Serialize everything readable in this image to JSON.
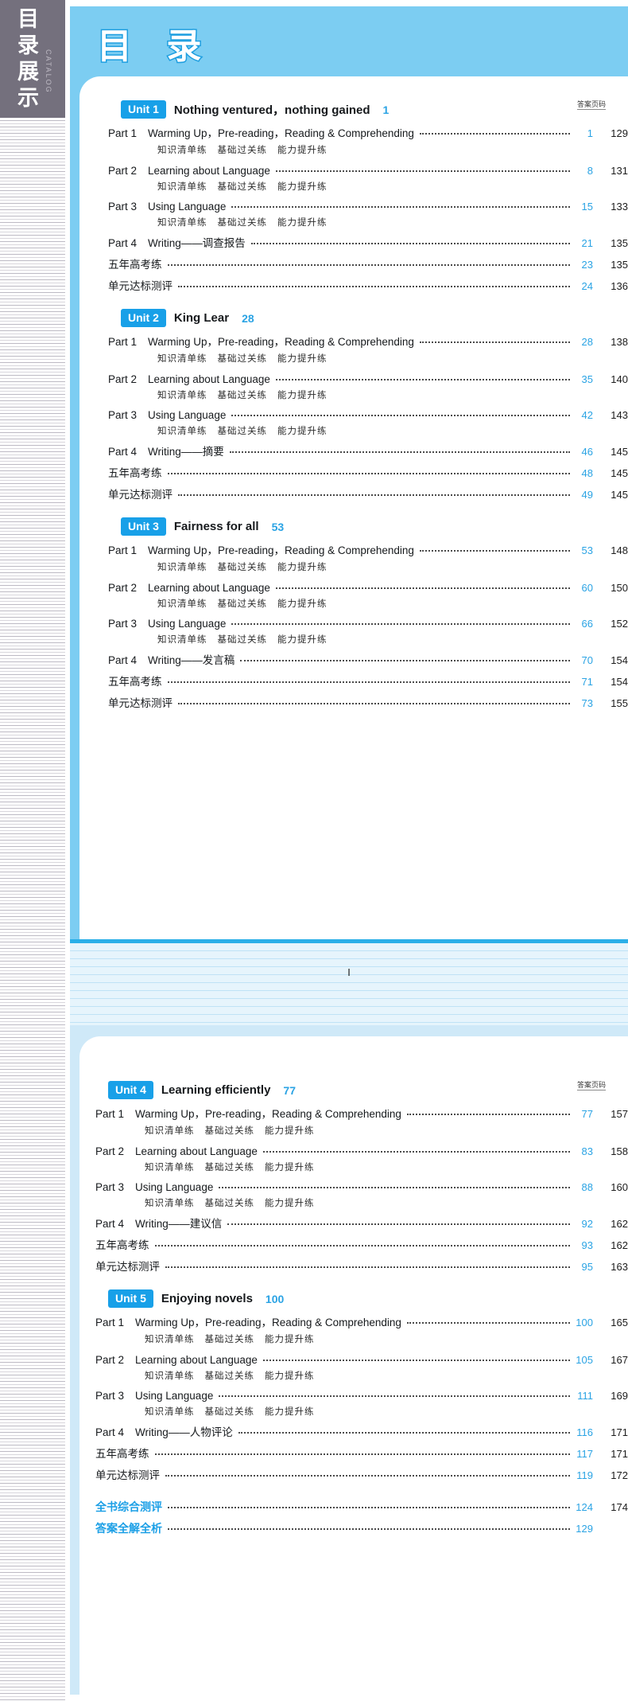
{
  "spine": {
    "title": "目录展示",
    "subtitle": "CATALOG"
  },
  "masthead": "目 录",
  "answer_header": "答案页码",
  "folio": "Ⅰ",
  "final_items": [
    {
      "name": "全书综合测评",
      "page": "124",
      "answer": "174"
    },
    {
      "name": "答案全解全析",
      "page": "129",
      "answer": ""
    }
  ],
  "sub_labels": [
    "知识清单练",
    "基础过关练",
    "能力提升练"
  ],
  "units": [
    {
      "badge": "Unit 1",
      "title": "Nothing ventured，nothing gained",
      "page": "1",
      "rows": [
        {
          "part": "Part 1",
          "name": "Warming Up，Pre-reading，Reading & Comprehending",
          "page": "1",
          "answer": "129",
          "sub": true
        },
        {
          "part": "Part 2",
          "name": "Learning about Language",
          "page": "8",
          "answer": "131",
          "sub": true
        },
        {
          "part": "Part 3",
          "name": "Using Language",
          "page": "15",
          "answer": "133",
          "sub": true
        },
        {
          "part": "Part 4",
          "name": "Writing——调查报告",
          "page": "21",
          "answer": "135",
          "sub": false
        },
        {
          "part": "",
          "name": "五年高考练",
          "page": "23",
          "answer": "135",
          "sub": false
        },
        {
          "part": "",
          "name": "单元达标测评",
          "page": "24",
          "answer": "136",
          "sub": false
        }
      ]
    },
    {
      "badge": "Unit 2",
      "title": "King Lear",
      "page": "28",
      "rows": [
        {
          "part": "Part 1",
          "name": "Warming Up，Pre-reading，Reading & Comprehending",
          "page": "28",
          "answer": "138",
          "sub": true
        },
        {
          "part": "Part 2",
          "name": "Learning about Language",
          "page": "35",
          "answer": "140",
          "sub": true
        },
        {
          "part": "Part 3",
          "name": "Using Language",
          "page": "42",
          "answer": "143",
          "sub": true
        },
        {
          "part": "Part 4",
          "name": "Writing——摘要",
          "page": "46",
          "answer": "145",
          "sub": false
        },
        {
          "part": "",
          "name": "五年高考练",
          "page": "48",
          "answer": "145",
          "sub": false
        },
        {
          "part": "",
          "name": "单元达标测评",
          "page": "49",
          "answer": "145",
          "sub": false
        }
      ]
    },
    {
      "badge": "Unit 3",
      "title": "Fairness for all",
      "page": "53",
      "rows": [
        {
          "part": "Part 1",
          "name": "Warming Up，Pre-reading，Reading & Comprehending",
          "page": "53",
          "answer": "148",
          "sub": true
        },
        {
          "part": "Part 2",
          "name": "Learning about Language",
          "page": "60",
          "answer": "150",
          "sub": true
        },
        {
          "part": "Part 3",
          "name": "Using Language",
          "page": "66",
          "answer": "152",
          "sub": true
        },
        {
          "part": "Part 4",
          "name": "Writing——发言稿",
          "page": "70",
          "answer": "154",
          "sub": false
        },
        {
          "part": "",
          "name": "五年高考练",
          "page": "71",
          "answer": "154",
          "sub": false
        },
        {
          "part": "",
          "name": "单元达标测评",
          "page": "73",
          "answer": "155",
          "sub": false
        }
      ]
    },
    {
      "badge": "Unit 4",
      "title": "Learning efficiently",
      "page": "77",
      "rows": [
        {
          "part": "Part 1",
          "name": "Warming Up，Pre-reading，Reading & Comprehending",
          "page": "77",
          "answer": "157",
          "sub": true
        },
        {
          "part": "Part 2",
          "name": "Learning about Language",
          "page": "83",
          "answer": "158",
          "sub": true
        },
        {
          "part": "Part 3",
          "name": "Using Language",
          "page": "88",
          "answer": "160",
          "sub": true
        },
        {
          "part": "Part 4",
          "name": "Writing——建议信",
          "page": "92",
          "answer": "162",
          "sub": false
        },
        {
          "part": "",
          "name": "五年高考练",
          "page": "93",
          "answer": "162",
          "sub": false
        },
        {
          "part": "",
          "name": "单元达标测评",
          "page": "95",
          "answer": "163",
          "sub": false
        }
      ]
    },
    {
      "badge": "Unit 5",
      "title": "Enjoying novels",
      "page": "100",
      "rows": [
        {
          "part": "Part 1",
          "name": "Warming Up，Pre-reading，Reading & Comprehending",
          "page": "100",
          "answer": "165",
          "sub": true
        },
        {
          "part": "Part 2",
          "name": "Learning about Language",
          "page": "105",
          "answer": "167",
          "sub": true
        },
        {
          "part": "Part 3",
          "name": "Using Language",
          "page": "111",
          "answer": "169",
          "sub": true
        },
        {
          "part": "Part 4",
          "name": "Writing——人物评论",
          "page": "116",
          "answer": "171",
          "sub": false
        },
        {
          "part": "",
          "name": "五年高考练",
          "page": "117",
          "answer": "171",
          "sub": false
        },
        {
          "part": "",
          "name": "单元达标测评",
          "page": "119",
          "answer": "172",
          "sub": false
        }
      ]
    }
  ],
  "colors": {
    "accent": "#18a0e8",
    "band": "#7ccdf2",
    "band_light": "#cfe9f8",
    "spine": "#74707d"
  }
}
